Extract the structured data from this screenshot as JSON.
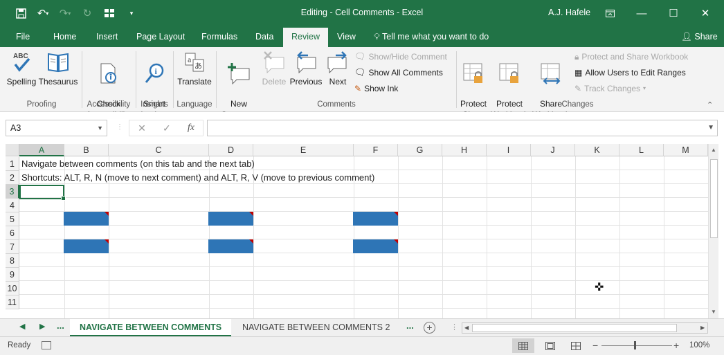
{
  "window": {
    "title": "Editing - Cell Comments  -  Excel",
    "user": "A.J. Hafele"
  },
  "menu_tabs": [
    "File",
    "Home",
    "Insert",
    "Page Layout",
    "Formulas",
    "Data",
    "Review",
    "View"
  ],
  "active_tab": "Review",
  "tell_me": "Tell me what you want to do",
  "share": "Share",
  "ribbon": {
    "proofing": {
      "label": "Proofing",
      "spelling": "Spelling",
      "thesaurus": "Thesaurus"
    },
    "accessibility": {
      "label": "Accessibility",
      "check": "Check\nAccessibility"
    },
    "insights": {
      "label": "Insights",
      "smart": "Smart\nLookup"
    },
    "language": {
      "label": "Language",
      "translate": "Translate"
    },
    "comments": {
      "label": "Comments",
      "new_comment": "New\nComment",
      "delete": "Delete",
      "previous": "Previous",
      "next": "Next",
      "show_hide": "Show/Hide Comment",
      "show_all": "Show All Comments",
      "show_ink": "Show Ink"
    },
    "changes": {
      "label": "Changes",
      "protect_sheet": "Protect\nSheet",
      "protect_workbook": "Protect\nWorkbook",
      "share_workbook": "Share\nWorkbook",
      "protect_share": "Protect and Share Workbook",
      "allow_users": "Allow Users to Edit Ranges",
      "track_changes": "Track Changes"
    }
  },
  "formula_bar": {
    "name_box": "A3",
    "cancel": "✕",
    "enter": "✓",
    "fx": "fx",
    "value": ""
  },
  "columns": [
    "A",
    "B",
    "C",
    "D",
    "E",
    "F",
    "G",
    "H",
    "I",
    "J",
    "K",
    "L",
    "M"
  ],
  "rows": [
    "1",
    "2",
    "3",
    "4",
    "5",
    "6",
    "7",
    "8",
    "9",
    "10",
    "11"
  ],
  "cells": {
    "a1": "Navigate between comments (on this tab and the next tab)",
    "a2": "Shortcuts: ALT, R, N (move to next comment) and ALT, R, V (move to previous comment)"
  },
  "sheets": [
    "NAVIGATE BETWEEN COMMENTS",
    "NAVIGATE BETWEEN COMMENTS 2"
  ],
  "sheet_nav": {
    "more": "..."
  },
  "status": {
    "ready": "Ready",
    "zoom": "100%"
  },
  "colors": {
    "brand": "#217346",
    "comment_cell": "#2e75b6",
    "comment_marker": "#c00000"
  }
}
